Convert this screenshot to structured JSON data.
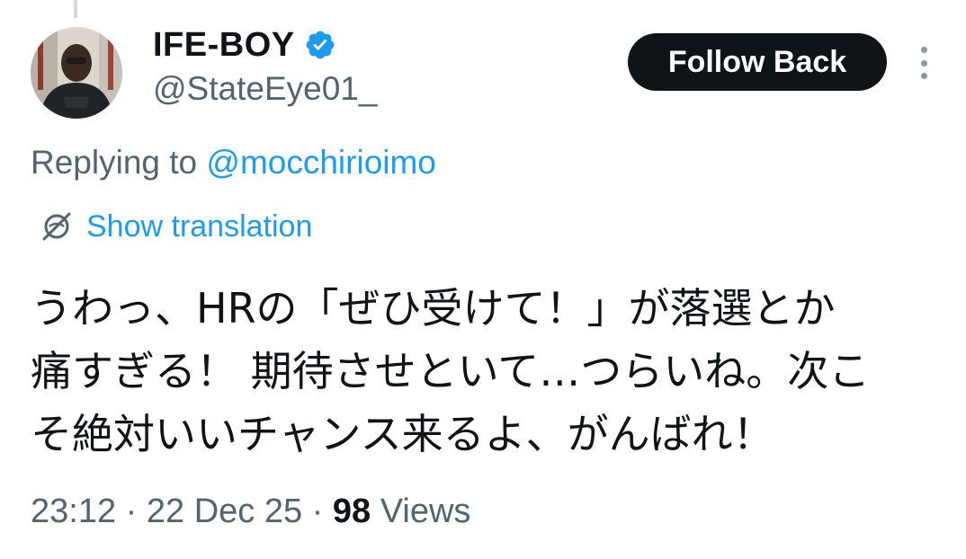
{
  "tweet": {
    "author": {
      "display_name": "IFE-BOY",
      "handle": "@StateEye01_",
      "verified": true,
      "avatar_icon": "user-avatar"
    },
    "follow_button_label": "Follow Back",
    "more_icon": "more-vertical-icon",
    "replying_prefix": "Replying to ",
    "replying_mention": "@mocchirioimo",
    "translation_label": "Show translation",
    "translation_icon": "translate-globe-icon",
    "text_lines": [
      "うわっ、HRの「ぜひ受けて！」が落選とか",
      "痛すぎる！ 期待させといて…つらいね。次こ",
      "そ絶対いいチャンス来るよ、がんばれ！"
    ],
    "time": "23:12",
    "separator": " · ",
    "date": "22 Dec 25",
    "views_count": "98",
    "views_label": " Views"
  },
  "colors": {
    "accent": "#1d9bf0",
    "text": "#0f1419",
    "secondary": "#536471",
    "button_bg": "#0f1419"
  }
}
